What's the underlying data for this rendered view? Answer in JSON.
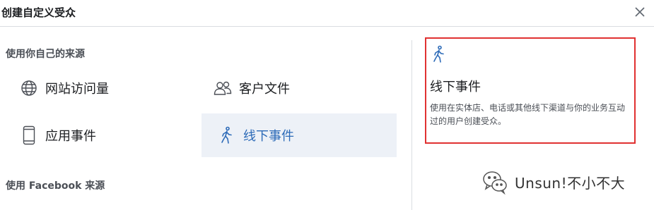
{
  "dialog": {
    "title": "创建自定义受众",
    "close_icon": "close-icon"
  },
  "sections": {
    "own_sources": "使用你自己的来源",
    "facebook_sources": "使用 Facebook 来源"
  },
  "sources": {
    "website": {
      "label": "网站访问量",
      "icon": "globe-icon"
    },
    "customer_file": {
      "label": "客户文件",
      "icon": "people-icon"
    },
    "app": {
      "label": "应用事件",
      "icon": "mobile-phone-icon"
    },
    "offline": {
      "label": "线下事件",
      "icon": "walking-person-icon",
      "selected": true
    }
  },
  "detail": {
    "icon": "walking-person-icon",
    "title": "线下事件",
    "description": "使用在实体店、电话或其他线下渠道与你的业务互动过的用户创建受众。"
  },
  "watermark": {
    "text": "Unsun!不小不大",
    "icon": "wechat-logo-icon"
  },
  "colors": {
    "accent": "#2d6bb8",
    "selected_bg": "#edf1f7",
    "highlight_border": "#e03131"
  }
}
